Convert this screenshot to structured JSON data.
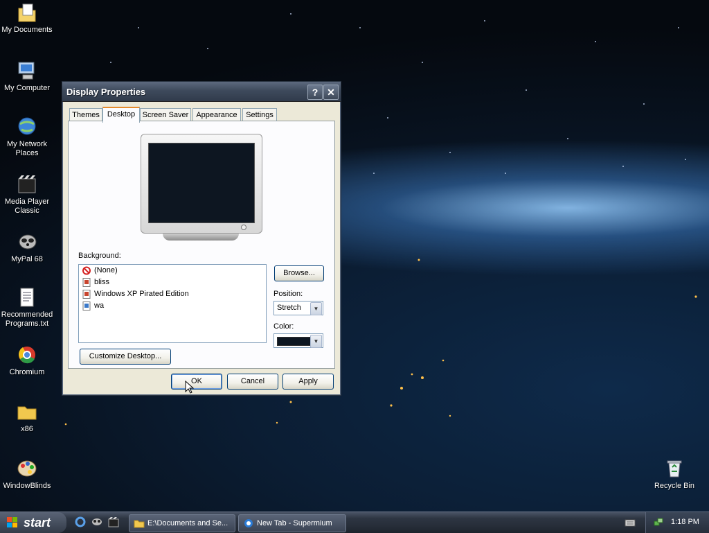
{
  "desktop": {
    "icons": [
      {
        "label": "My Documents",
        "icon": "my-documents-icon"
      },
      {
        "label": "My Computer",
        "icon": "my-computer-icon"
      },
      {
        "label": "My Network Places",
        "icon": "network-places-icon"
      },
      {
        "label": "Media Player Classic",
        "icon": "media-player-icon"
      },
      {
        "label": "MyPal 68",
        "icon": "mypal-icon"
      },
      {
        "label": "Recommended Programs.txt",
        "icon": "text-file-icon"
      },
      {
        "label": "Chromium",
        "icon": "chromium-icon"
      },
      {
        "label": "x86",
        "icon": "folder-icon"
      },
      {
        "label": "WindowBlinds",
        "icon": "windowblinds-icon"
      },
      {
        "label": "Recycle Bin",
        "icon": "recycle-bin-icon"
      }
    ]
  },
  "dialog": {
    "title": "Display Properties",
    "help_glyph": "?",
    "close_glyph": "✕",
    "tabs": [
      "Themes",
      "Desktop",
      "Screen Saver",
      "Appearance",
      "Settings"
    ],
    "active_tab": "Desktop",
    "background_label": "Background:",
    "background_items": [
      "(None)",
      "bliss",
      "Windows XP Pirated Edition",
      "wa"
    ],
    "browse_label": "Browse...",
    "position_label": "Position:",
    "position_value": "Stretch",
    "color_label": "Color:",
    "color_value": "#0d1621",
    "customize_label": "Customize Desktop...",
    "ok_label": "OK",
    "cancel_label": "Cancel",
    "apply_label": "Apply"
  },
  "taskbar": {
    "start_label": "start",
    "tasks": [
      "E:\\Documents and Se...",
      "New Tab - Supermium"
    ],
    "clock": "1:18 PM"
  },
  "colors": {
    "xp_accent": "#e68b2c",
    "window_face": "#ece9d8",
    "taskbar": "#2d3542"
  }
}
